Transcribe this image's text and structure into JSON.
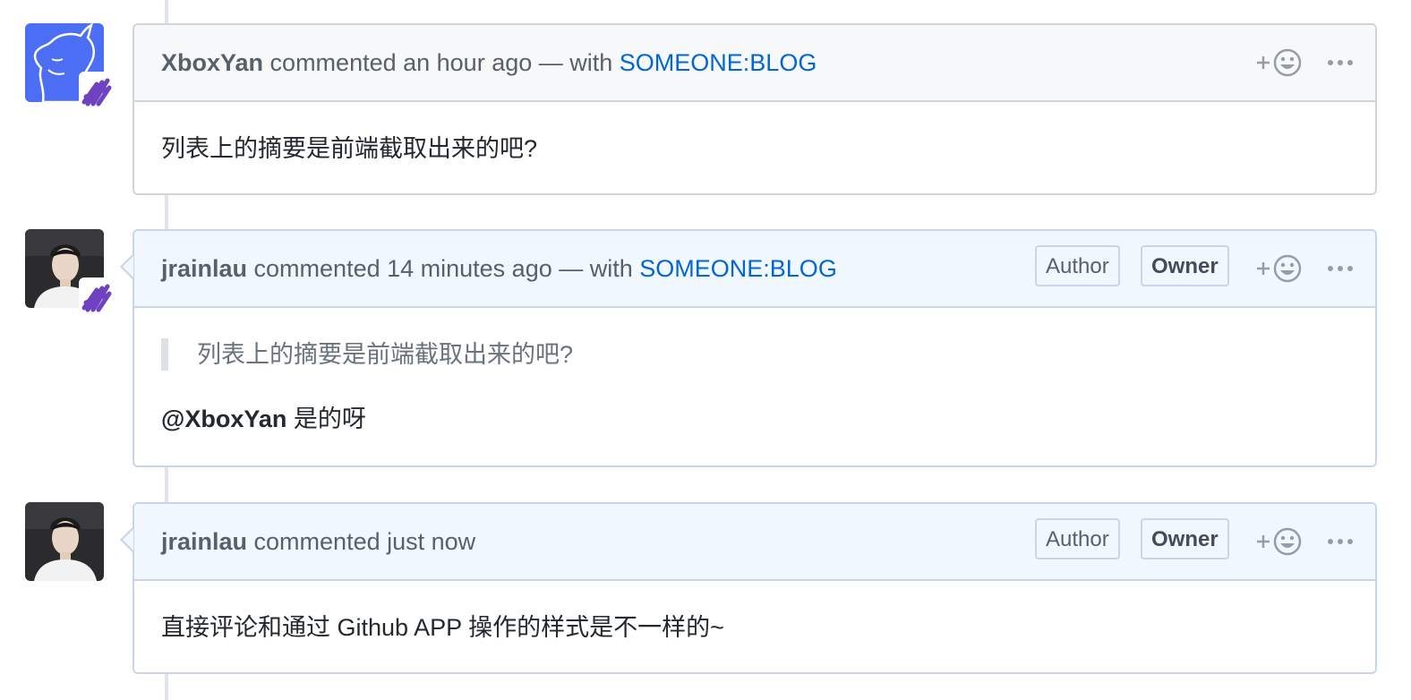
{
  "comments": [
    {
      "author": "XboxYan",
      "action": " commented an hour ago",
      "with_text": " — with ",
      "app": "SOMEONE:BLOG",
      "body": "列表上的摘要是前端截取出来的吧?"
    },
    {
      "author": "jrainlau",
      "action": " commented 14 minutes ago",
      "with_text": " — with ",
      "app": "SOMEONE:BLOG",
      "labels": [
        "Author",
        "Owner"
      ],
      "quote": "列表上的摘要是前端截取出来的吧?",
      "mention": "@XboxYan",
      "reply": " 是的呀"
    },
    {
      "author": "jrainlau",
      "action": " commented just now",
      "labels": [
        "Author",
        "Owner"
      ],
      "body": "直接评论和通过 Github APP 操作的样式是不一样的~"
    }
  ],
  "colors": {
    "link": "#0366d6",
    "owner_border": "#c8d5ea",
    "owner_header": "#f1f8ff",
    "default_header": "#f6f8fa",
    "bot_badge": "#6f42c1",
    "avatar_blue": "#4b6ef5"
  },
  "icons": {
    "reaction": "add-reaction-smiley-icon",
    "more": "kebab-horizontal-icon",
    "bot": "app-bot-badge-icon"
  }
}
